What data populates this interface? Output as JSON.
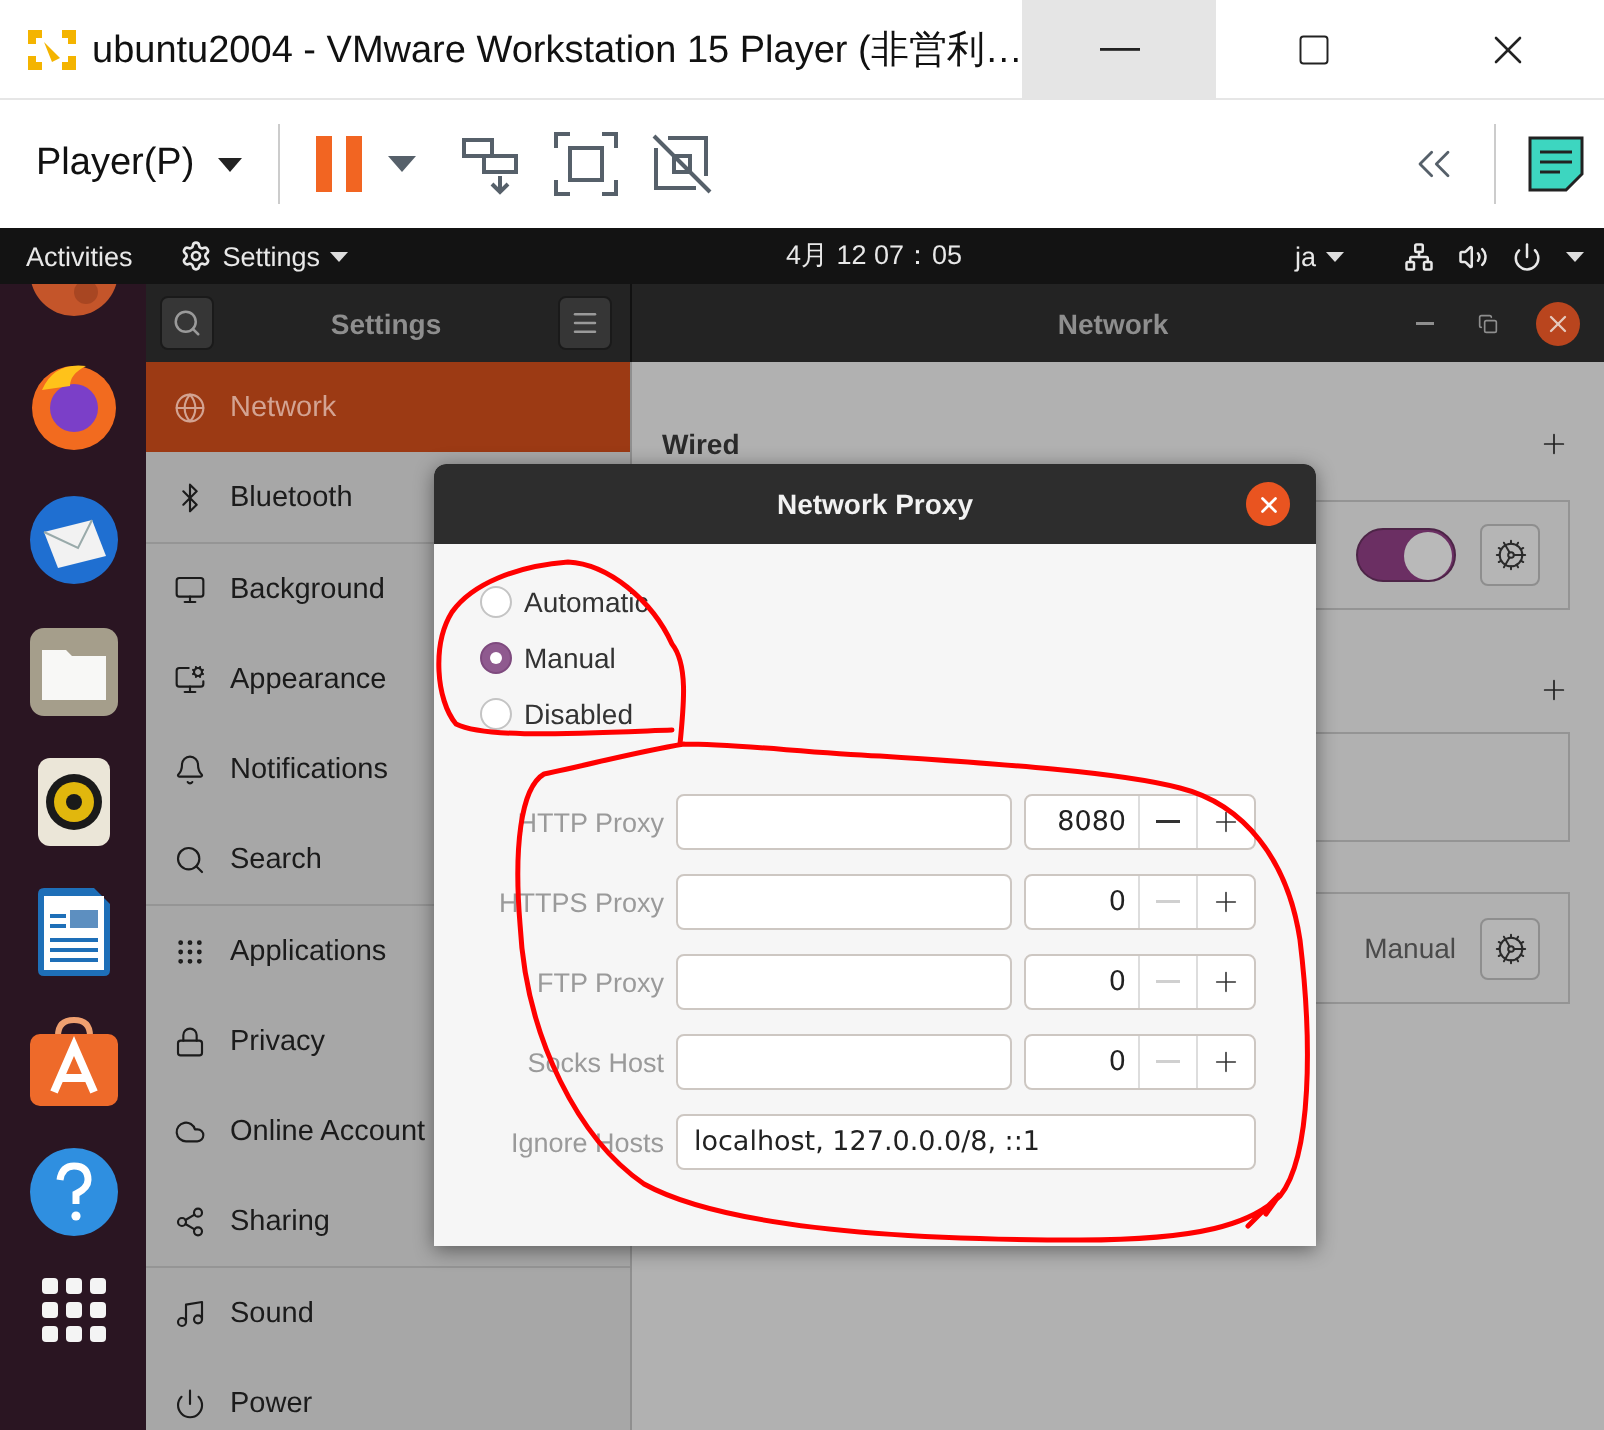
{
  "window": {
    "title": "ubuntu2004 - VMware Workstation 15 Player (非営利…"
  },
  "toolbar": {
    "menu": "Player(P)"
  },
  "top_bar": {
    "activities": "Activities",
    "app_menu": "Settings",
    "clock": "4月 12 07：05",
    "input_method": "ja"
  },
  "settings": {
    "title": "Settings",
    "page_title": "Network",
    "sidebar": [
      {
        "items": [
          {
            "label": "Network",
            "selected": true
          },
          {
            "label": "Bluetooth",
            "selected": false
          }
        ]
      },
      {
        "items": [
          {
            "label": "Background",
            "selected": false
          },
          {
            "label": "Appearance",
            "selected": false
          },
          {
            "label": "Notifications",
            "selected": false
          },
          {
            "label": "Search",
            "selected": false
          }
        ]
      },
      {
        "items": [
          {
            "label": "Applications",
            "selected": false
          },
          {
            "label": "Privacy",
            "selected": false
          },
          {
            "label": "Online Account",
            "selected": false
          },
          {
            "label": "Sharing",
            "selected": false
          }
        ]
      },
      {
        "items": [
          {
            "label": "Sound",
            "selected": false
          },
          {
            "label": "Power",
            "selected": false
          }
        ]
      }
    ],
    "wired": {
      "title": "Wired",
      "on": true
    },
    "proxy": {
      "value": "Manual"
    }
  },
  "dialog": {
    "title": "Network Proxy",
    "modes": [
      {
        "label": "Automatic",
        "selected": false
      },
      {
        "label": "Manual",
        "selected": true
      },
      {
        "label": "Disabled",
        "selected": false
      }
    ],
    "proxies": [
      {
        "label": "HTTP Proxy",
        "port": "8080",
        "decrease_disabled": false
      },
      {
        "label": "HTTPS Proxy",
        "port": "0",
        "decrease_disabled": true
      },
      {
        "label": "FTP Proxy",
        "port": "0",
        "decrease_disabled": true
      },
      {
        "label": "Socks Host",
        "port": "0",
        "decrease_disabled": true
      }
    ],
    "ignore_hosts": {
      "label": "Ignore Hosts",
      "value": "localhost, 127.0.0.0/8, ::1"
    }
  }
}
